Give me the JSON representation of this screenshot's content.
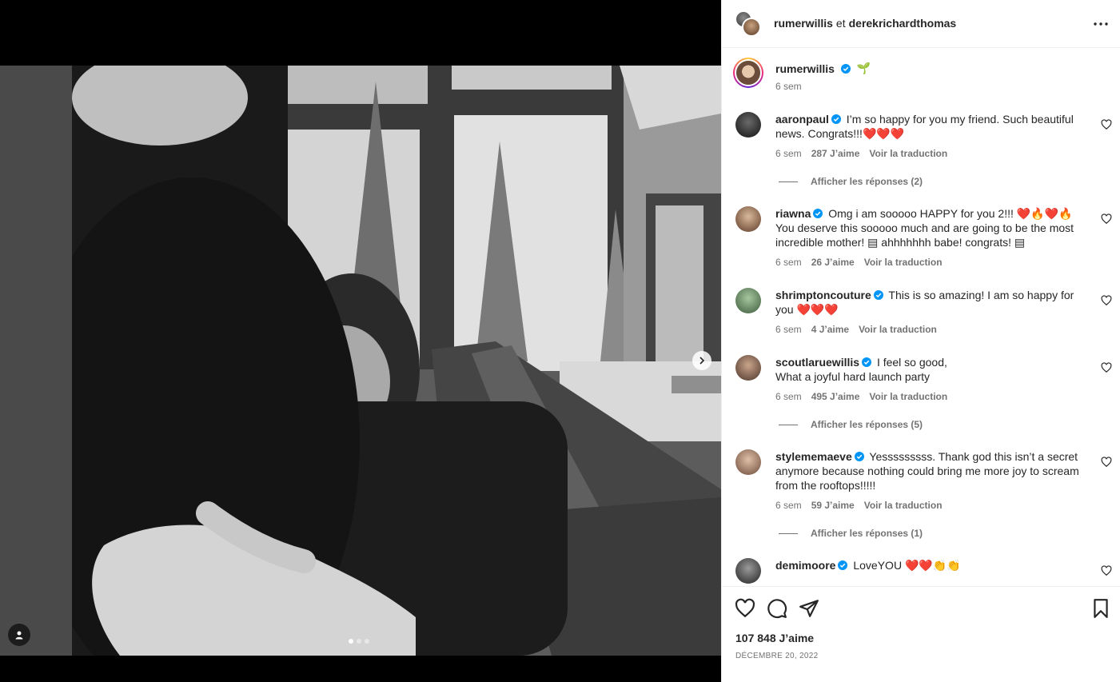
{
  "post": {
    "header": {
      "user1": "rumerwillis",
      "connector": "et",
      "user2": "derekrichardthomas"
    },
    "carousel": {
      "count": 3,
      "active": 0
    }
  },
  "caption": {
    "user": "rumerwillis",
    "emoji": "🌱",
    "time": "6 sem"
  },
  "comments": [
    {
      "user": "aaronpaul",
      "text": "I’m so happy for you my friend. Such beautiful news. Congrats!!!❤️❤️❤️",
      "time": "6 sem",
      "likes": "287 J’aime",
      "translate": "Voir la traduction",
      "replies": "Afficher les réponses (2)"
    },
    {
      "user": "riawna",
      "text": "Omg i am sooooo HAPPY for you 2!!! ❤️🔥❤️🔥 You deserve this sooooo much and are going to be the most incredible mother! ▤ ahhhhhhh babe! congrats! ▤",
      "time": "6 sem",
      "likes": "26 J’aime",
      "translate": "Voir la traduction"
    },
    {
      "user": "shrimptoncouture",
      "text": "This is so amazing! I am so happy for you ❤️❤️❤️",
      "time": "6 sem",
      "likes": "4 J’aime",
      "translate": "Voir la traduction"
    },
    {
      "user": "scoutlaruewillis",
      "text": "I feel so good,\nWhat a joyful hard launch party",
      "time": "6 sem",
      "likes": "495 J’aime",
      "translate": "Voir la traduction",
      "replies": "Afficher les réponses (5)"
    },
    {
      "user": "stylememaeve",
      "text": "Yesssssssss. Thank god this isn’t a secret anymore because nothing could bring me more joy to scream from the rooftops!!!!!",
      "time": "6 sem",
      "likes": "59 J’aime",
      "translate": "Voir la traduction",
      "replies": "Afficher les réponses (1)"
    },
    {
      "user": "demimoore",
      "text": "LoveYOU ❤️❤️👏👏"
    }
  ],
  "stats": {
    "likes": "107 848 J’aime",
    "date": "DÉCEMBRE 20, 2022"
  },
  "icons": {
    "like": "heart-icon",
    "comment": "comment-icon",
    "share": "share-icon",
    "save": "bookmark-icon",
    "more": "more-icon",
    "verified": "verified-badge-icon"
  },
  "colors": {
    "verified": "#0095f6",
    "muted": "#737373"
  }
}
